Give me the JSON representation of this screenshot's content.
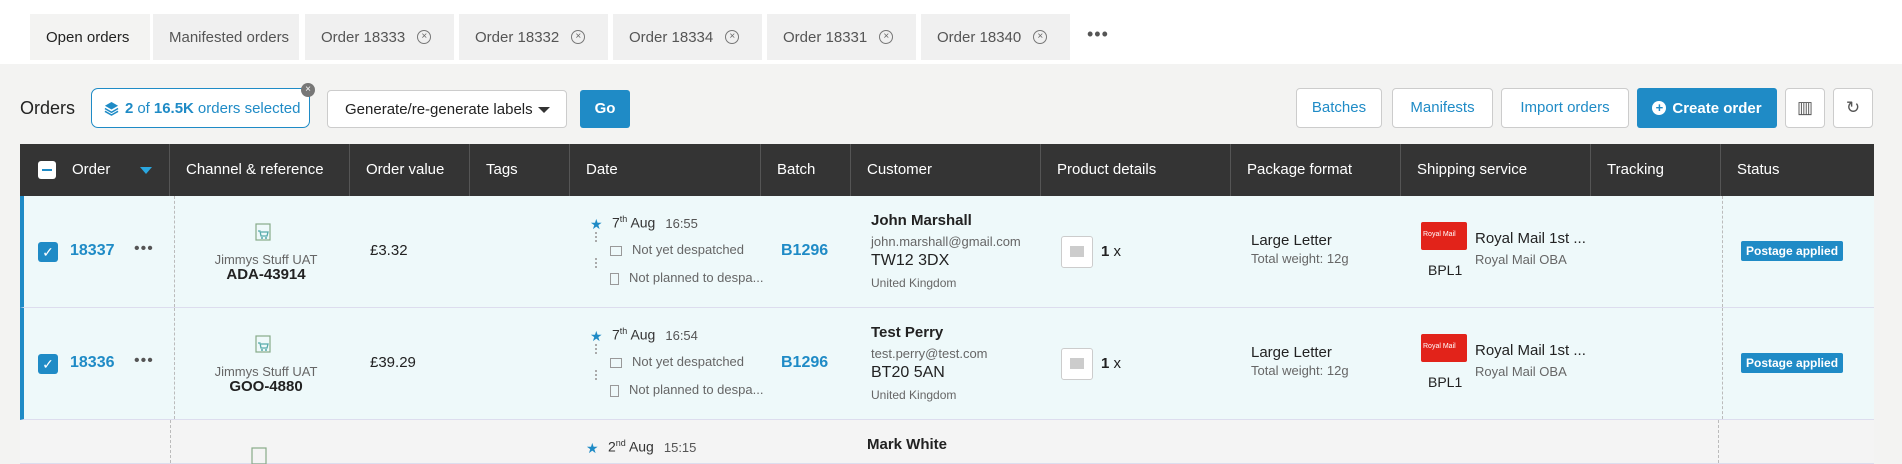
{
  "tabs": [
    {
      "label": "Open orders"
    },
    {
      "label": "Manifested orders"
    },
    {
      "label": "Order 18333"
    },
    {
      "label": "Order 18332"
    },
    {
      "label": "Order 18334"
    },
    {
      "label": "Order 18331"
    },
    {
      "label": "Order 18340"
    }
  ],
  "tabs_more": "•••",
  "toolbar": {
    "title": "Orders",
    "selected_count": "2",
    "selected_of": "of",
    "selected_total": "16.5K",
    "selected_suffix": "orders selected",
    "action_select": "Generate/re-generate labels",
    "go": "Go",
    "batches": "Batches",
    "manifests": "Manifests",
    "import_orders": "Import orders",
    "create_order": "Create order"
  },
  "columns": [
    "Order",
    "Channel & reference",
    "Order value",
    "Tags",
    "Date",
    "Batch",
    "Customer",
    "Product details",
    "Package format",
    "Shipping service",
    "Tracking",
    "Status"
  ],
  "orders": [
    {
      "number": "18337",
      "channel": "Jimmys Stuff UAT",
      "reference": "ADA-43914",
      "value": "£3.32",
      "date_day": "7",
      "date_suffix": "th",
      "date_month": "Aug",
      "time": "16:55",
      "despatch": "Not yet despatched",
      "planned": "Not planned to despa...",
      "batch": "B1296",
      "customer_name": "John Marshall",
      "customer_email": "john.marshall@gmail.com",
      "postcode": "TW12 3DX",
      "country": "United Kingdom",
      "qty": "1",
      "qty_x": "x",
      "package": "Large Letter",
      "weight": "Total weight: 12g",
      "carrier_logo": "Royal Mail",
      "carrier_code": "BPL1",
      "service": "Royal Mail 1st ...",
      "service_sub": "Royal Mail OBA",
      "status": "Postage applied"
    },
    {
      "number": "18336",
      "channel": "Jimmys Stuff UAT",
      "reference": "GOO-4880",
      "value": "£39.29",
      "date_day": "7",
      "date_suffix": "th",
      "date_month": "Aug",
      "time": "16:54",
      "despatch": "Not yet despatched",
      "planned": "Not planned to despa...",
      "batch": "B1296",
      "customer_name": "Test Perry",
      "customer_email": "test.perry@test.com",
      "postcode": "BT20 5AN",
      "country": "United Kingdom",
      "qty": "1",
      "qty_x": "x",
      "package": "Large Letter",
      "weight": "Total weight: 12g",
      "carrier_logo": "Royal Mail",
      "carrier_code": "BPL1",
      "service": "Royal Mail 1st ...",
      "service_sub": "Royal Mail OBA",
      "status": "Postage applied"
    },
    {
      "date_day": "2",
      "date_suffix": "nd",
      "date_month": "Aug",
      "time": "15:15",
      "customer_name": "Mark White"
    }
  ],
  "colors": {
    "accent": "#1f8bc6",
    "header": "#343434",
    "row_selected": "#eef9fa"
  }
}
